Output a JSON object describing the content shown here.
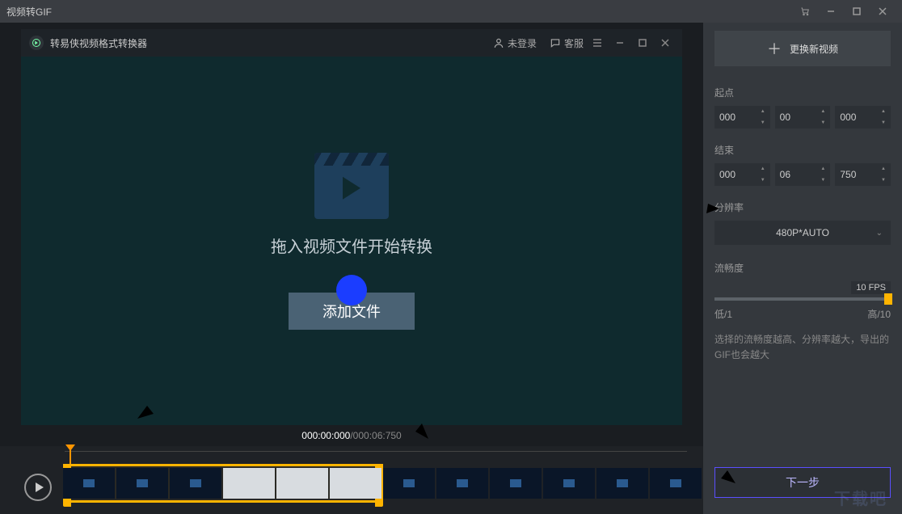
{
  "window": {
    "title": "视频转GIF"
  },
  "inner": {
    "title": "转易侠视频格式转换器",
    "login": "未登录",
    "support": "客服"
  },
  "drop": {
    "hint": "拖入视频文件开始转换",
    "add_btn": "添加文件"
  },
  "time": {
    "current": "000:00:000",
    "sep": " / ",
    "total": "000:06:750"
  },
  "panel": {
    "replace": "更换新视频",
    "start_label": "起点",
    "start": {
      "h": "000",
      "m": "00",
      "s": "000"
    },
    "end_label": "结束",
    "end": {
      "h": "000",
      "m": "06",
      "s": "750"
    },
    "res_label": "分辨率",
    "res_value": "480P*AUTO",
    "smooth_label": "流畅度",
    "fps": "10 FPS",
    "low": "低/1",
    "high": "高/10",
    "help": "选择的流畅度越高、分辨率越大，导出的GIF也会越大",
    "next": "下一步"
  },
  "watermark": "下载吧"
}
